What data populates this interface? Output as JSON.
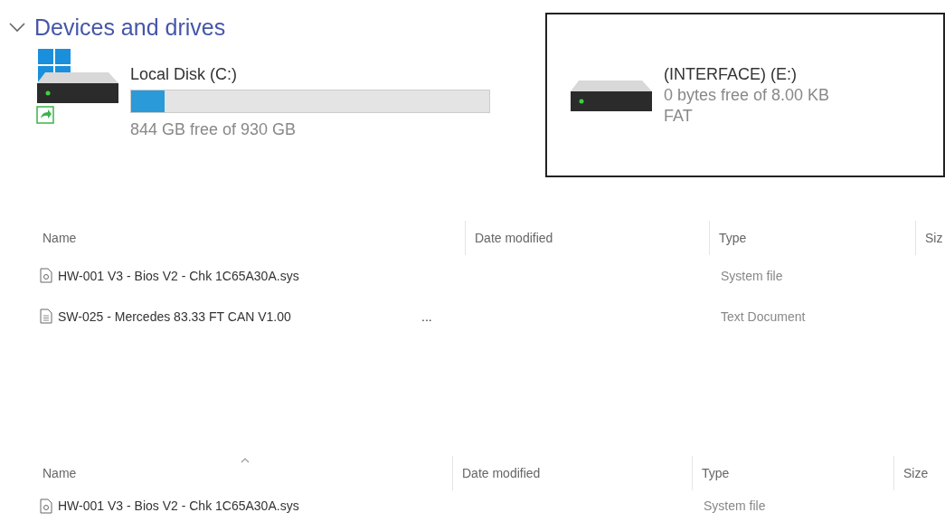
{
  "section": {
    "title": "Devices and drives",
    "expanded": true
  },
  "drives": [
    {
      "name": "Local Disk (C:)",
      "kind": "system",
      "level": 0.093,
      "details": [
        "844 GB free of 930 GB"
      ],
      "selected": false
    },
    {
      "name": "(INTERFACE) (E:)",
      "kind": "removable",
      "details": [
        "0 bytes free of 8.00 KB",
        "FAT"
      ],
      "selected": true
    }
  ],
  "tables": [
    {
      "columns": [
        {
          "label": "Name",
          "sorted": false
        },
        {
          "label": "Date modified",
          "sorted": false
        },
        {
          "label": "Type",
          "sorted": false
        },
        {
          "label": "Siz",
          "sorted": false
        }
      ],
      "rows": [
        {
          "kind": "system",
          "name": "HW-001 V3 - Bios V2 - Chk 1C65A30A.sys",
          "type": "System file"
        },
        {
          "kind": "text",
          "name": "SW-025 - Mercedes 83.33 FT CAN V1.00",
          "extra": "...",
          "type": "Text Document"
        }
      ]
    },
    {
      "columns": [
        {
          "label": "Name",
          "sorted": true
        },
        {
          "label": "Date modified",
          "sorted": false
        },
        {
          "label": "Type",
          "sorted": false
        },
        {
          "label": "Size",
          "sorted": false
        }
      ],
      "rows": [
        {
          "kind": "system",
          "name": "HW-001 V3 - Bios V2 - Chk 1C65A30A.sys",
          "type": "System file"
        }
      ]
    }
  ]
}
